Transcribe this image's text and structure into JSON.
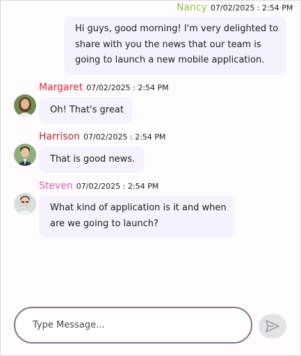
{
  "messages": [
    {
      "author": "Nancy",
      "author_color": "#8dc63f",
      "time": "07/02/2025 : 2:54 PM",
      "text_lines": [
        "Hi guys, good morning! I'm very delighted to",
        "share with you the news that our team is",
        "going to launch a new mobile application."
      ],
      "outgoing": true
    },
    {
      "author": "Margaret",
      "author_color": "#e8262a",
      "time": "07/02/2025 : 2:54 PM",
      "text_lines": [
        "Oh! That's great"
      ],
      "avatar_icon": "margaret-avatar"
    },
    {
      "author": "Harrison",
      "author_color": "#b32b2b",
      "time": "07/02/2025 : 2:54 PM",
      "text_lines": [
        "That is good news."
      ],
      "avatar_icon": "harrison-avatar"
    },
    {
      "author": "Steven",
      "author_color": "#e85aa8",
      "time": "07/02/2025 : 2:54 PM",
      "text_lines": [
        "What kind of application is it and when",
        "are we going to launch?"
      ],
      "avatar_icon": "steven-avatar"
    }
  ],
  "composer": {
    "placeholder": "Type Message...",
    "send_icon": "send-icon"
  },
  "colors": {
    "bubble": "#f6f1fd",
    "background": "#fffbfe",
    "composer_border": "#79747e",
    "send_button_bg": "#e6e1e6"
  }
}
